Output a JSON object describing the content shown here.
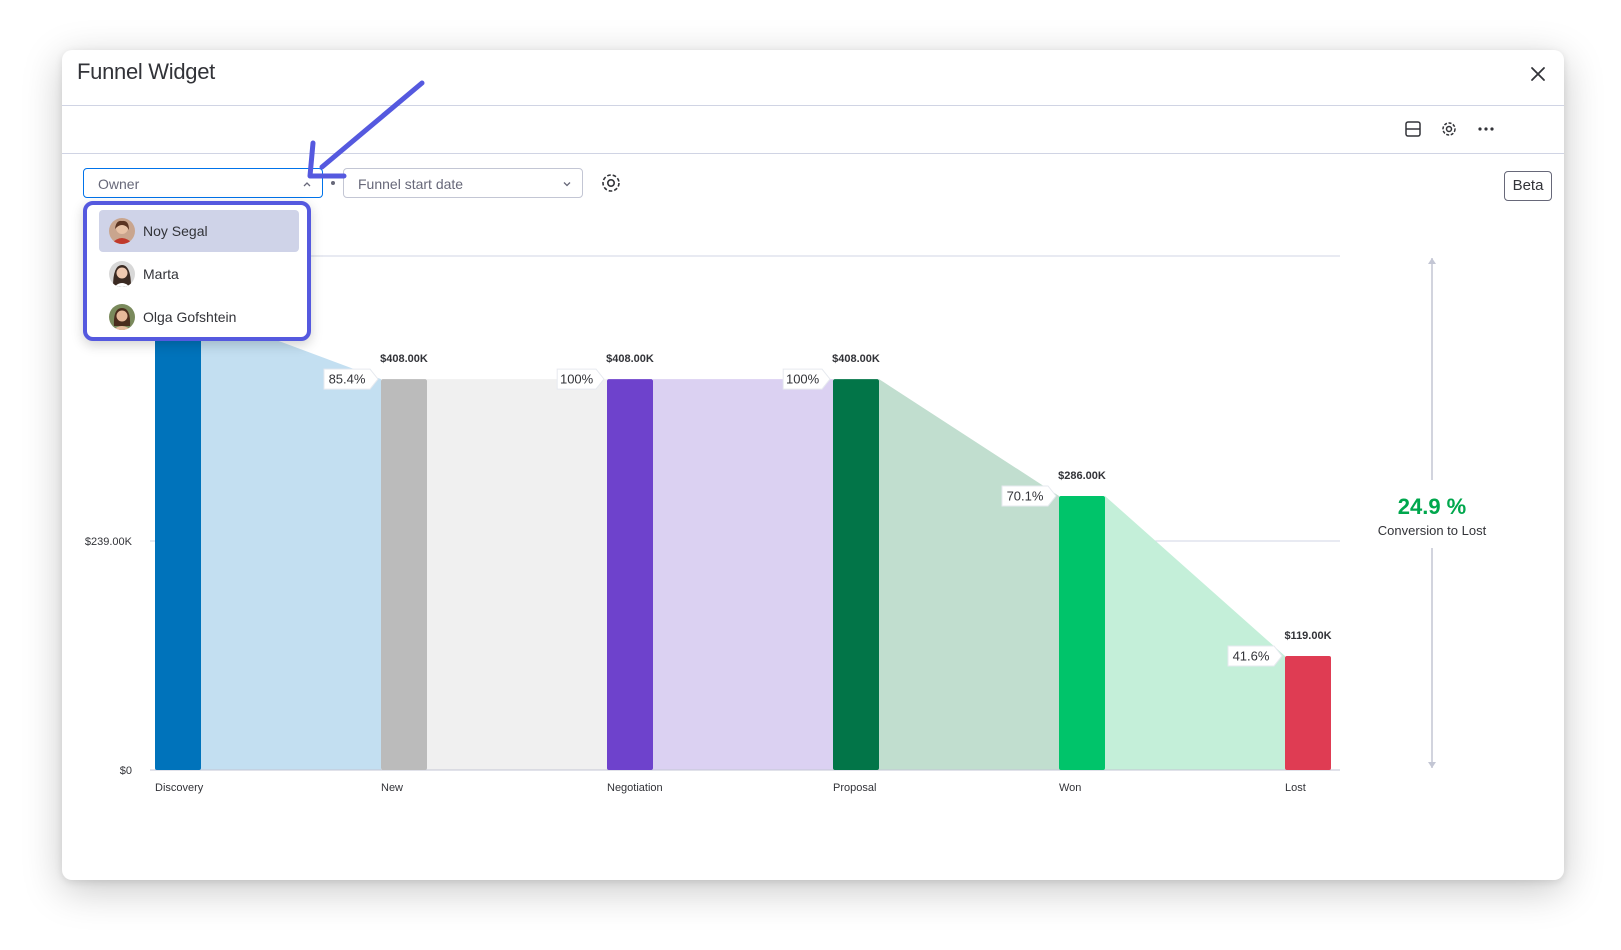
{
  "window": {
    "title": "Funnel Widget"
  },
  "filters": {
    "owner": {
      "placeholder": "Owner",
      "state": "open"
    },
    "start_date": {
      "placeholder": "Funnel start date"
    },
    "beta_label": "Beta"
  },
  "owner_options": [
    {
      "name": "Noy Segal",
      "selected": true
    },
    {
      "name": "Marta",
      "selected": false
    },
    {
      "name": "Olga Gofshtein",
      "selected": false
    }
  ],
  "icons": {
    "close": "close-icon",
    "layout": "layout-icon",
    "settings": "gear-icon",
    "more": "more-icon",
    "funnel_settings": "gear-icon"
  },
  "chart_data": {
    "type": "bar",
    "categories": [
      "Discovery",
      "New",
      "Negotiation",
      "Proposal",
      "Won",
      "Lost"
    ],
    "values": [
      478,
      408,
      408,
      408,
      286,
      119
    ],
    "value_labels": [
      "",
      "$408.00K",
      "$408.00K",
      "$408.00K",
      "$286.00K",
      "$119.00K"
    ],
    "step_conversions": [
      "",
      "85.4%",
      "100%",
      "100%",
      "70.1%",
      "41.6%"
    ],
    "colors": [
      "#0073bb",
      "#bbbbbb",
      "#6e42cc",
      "#027548",
      "#00c46a",
      "#df3c53"
    ],
    "connector_colors": [
      "#c3dff1",
      "#f0f0f0",
      "#dbd1f2",
      "#c1decf",
      "#c4efd9"
    ],
    "y_ticks": [
      {
        "value": 0,
        "label": "$0"
      },
      {
        "value": 239,
        "label": "$239.00K"
      }
    ],
    "ylim": [
      0,
      478
    ],
    "summary": {
      "value": "24.9 %",
      "label": "Conversion to Lost",
      "color": "#00a74d"
    }
  }
}
